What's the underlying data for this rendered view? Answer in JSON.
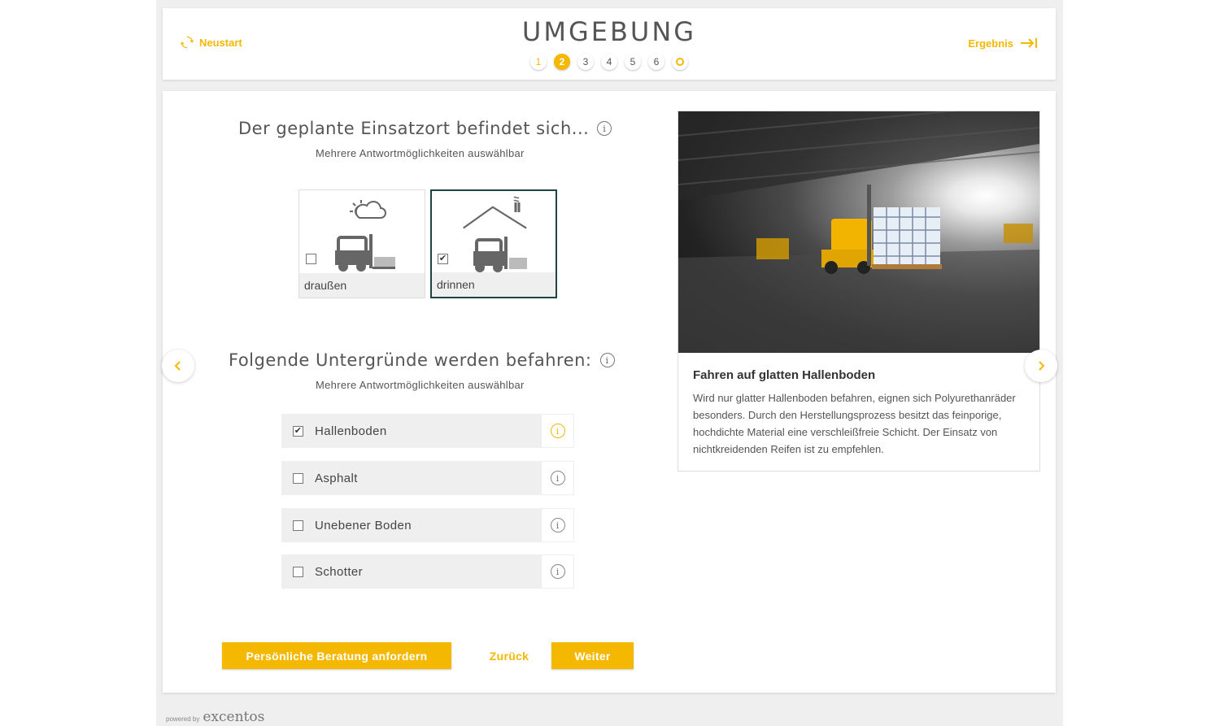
{
  "header": {
    "restart_label": "Neustart",
    "title": "UMGEBUNG",
    "result_label": "Ergebnis",
    "steps": [
      "1",
      "2",
      "3",
      "4",
      "5",
      "6"
    ]
  },
  "question1": {
    "title": "Der geplante Einsatzort befindet sich...",
    "hint": "Mehrere Antwortmöglichkeiten auswählbar",
    "options": [
      {
        "label": "draußen",
        "checked": false,
        "icon": "outdoor-forklift-icon"
      },
      {
        "label": "drinnen",
        "checked": true,
        "icon": "indoor-forklift-icon"
      }
    ]
  },
  "question2": {
    "title": "Folgende Untergründe werden befahren:",
    "hint": "Mehrere Antwortmöglichkeiten auswählbar",
    "options": [
      {
        "label": "Hallenboden",
        "checked": true
      },
      {
        "label": "Asphalt",
        "checked": false
      },
      {
        "label": "Unebener Boden",
        "checked": false
      },
      {
        "label": "Schotter",
        "checked": false
      }
    ]
  },
  "info_panel": {
    "title": "Fahren auf glatten Hallenboden",
    "text": "Wird nur glatter Hallenboden befahren, eignen sich Polyurethanräder besonders. Durch den Herstellungsprozess besitzt das feinporige, hochdichte Material eine verschleißfreie Schicht. Der Einsatz von nichtkreidenden Reifen ist zu empfehlen."
  },
  "buttons": {
    "consult": "Persönliche Beratung anfordern",
    "back": "Zurück",
    "next": "Weiter"
  },
  "footer": {
    "powered_by": "powered by",
    "brand": "excentos"
  },
  "colors": {
    "accent": "#f5b800",
    "selected_border": "#1f4444"
  }
}
